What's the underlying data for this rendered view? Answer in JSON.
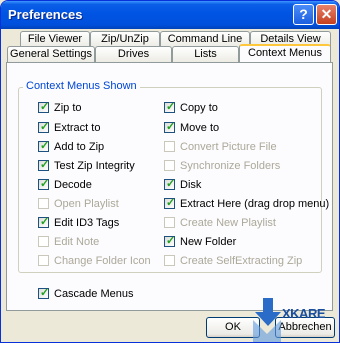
{
  "window": {
    "title": "Preferences"
  },
  "title_buttons": {
    "help": "?",
    "close": "✕"
  },
  "tabs_back": [
    "File Viewer",
    "Zip/UnZip",
    "Command Line",
    "Details View"
  ],
  "tabs_front": [
    "General Settings",
    "Drives",
    "Lists",
    "Context Menus"
  ],
  "active_tab": "Context Menus",
  "group_label": "Context Menus Shown",
  "options_left": [
    {
      "label": "Zip to",
      "checked": true,
      "enabled": true
    },
    {
      "label": "Extract  to",
      "checked": true,
      "enabled": true
    },
    {
      "label": "Add to Zip",
      "checked": true,
      "enabled": true
    },
    {
      "label": "Test Zip Integrity",
      "checked": true,
      "enabled": true
    },
    {
      "label": "Decode",
      "checked": true,
      "enabled": true
    },
    {
      "label": "Open Playlist",
      "checked": false,
      "enabled": false
    },
    {
      "label": "Edit ID3 Tags",
      "checked": true,
      "enabled": true
    },
    {
      "label": "Edit Note",
      "checked": false,
      "enabled": false
    },
    {
      "label": "Change Folder Icon",
      "checked": false,
      "enabled": false
    }
  ],
  "options_right": [
    {
      "label": "Copy to",
      "checked": true,
      "enabled": true
    },
    {
      "label": "Move to",
      "checked": true,
      "enabled": true
    },
    {
      "label": "Convert Picture File",
      "checked": false,
      "enabled": false
    },
    {
      "label": "Synchronize Folders",
      "checked": false,
      "enabled": false
    },
    {
      "label": "Disk",
      "checked": true,
      "enabled": true
    },
    {
      "label": "Extract Here (drag drop menu)",
      "checked": true,
      "enabled": true
    },
    {
      "label": "Create New Playlist",
      "checked": false,
      "enabled": false
    },
    {
      "label": "New Folder",
      "checked": true,
      "enabled": true
    },
    {
      "label": "Create SelfExtracting Zip",
      "checked": false,
      "enabled": false
    }
  ],
  "cascade": {
    "label": "Cascade Menus",
    "checked": true,
    "enabled": true
  },
  "buttons": {
    "ok": "OK",
    "cancel": "Abbrechen"
  },
  "watermark": "XKARE"
}
